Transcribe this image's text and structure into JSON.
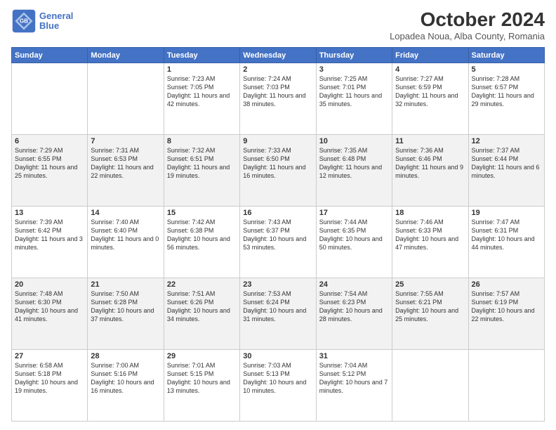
{
  "header": {
    "logo_line1": "General",
    "logo_line2": "Blue",
    "month": "October 2024",
    "location": "Lopadea Noua, Alba County, Romania"
  },
  "days_of_week": [
    "Sunday",
    "Monday",
    "Tuesday",
    "Wednesday",
    "Thursday",
    "Friday",
    "Saturday"
  ],
  "weeks": [
    [
      {
        "day": "",
        "info": ""
      },
      {
        "day": "",
        "info": ""
      },
      {
        "day": "1",
        "info": "Sunrise: 7:23 AM\nSunset: 7:05 PM\nDaylight: 11 hours and 42 minutes."
      },
      {
        "day": "2",
        "info": "Sunrise: 7:24 AM\nSunset: 7:03 PM\nDaylight: 11 hours and 38 minutes."
      },
      {
        "day": "3",
        "info": "Sunrise: 7:25 AM\nSunset: 7:01 PM\nDaylight: 11 hours and 35 minutes."
      },
      {
        "day": "4",
        "info": "Sunrise: 7:27 AM\nSunset: 6:59 PM\nDaylight: 11 hours and 32 minutes."
      },
      {
        "day": "5",
        "info": "Sunrise: 7:28 AM\nSunset: 6:57 PM\nDaylight: 11 hours and 29 minutes."
      }
    ],
    [
      {
        "day": "6",
        "info": "Sunrise: 7:29 AM\nSunset: 6:55 PM\nDaylight: 11 hours and 25 minutes."
      },
      {
        "day": "7",
        "info": "Sunrise: 7:31 AM\nSunset: 6:53 PM\nDaylight: 11 hours and 22 minutes."
      },
      {
        "day": "8",
        "info": "Sunrise: 7:32 AM\nSunset: 6:51 PM\nDaylight: 11 hours and 19 minutes."
      },
      {
        "day": "9",
        "info": "Sunrise: 7:33 AM\nSunset: 6:50 PM\nDaylight: 11 hours and 16 minutes."
      },
      {
        "day": "10",
        "info": "Sunrise: 7:35 AM\nSunset: 6:48 PM\nDaylight: 11 hours and 12 minutes."
      },
      {
        "day": "11",
        "info": "Sunrise: 7:36 AM\nSunset: 6:46 PM\nDaylight: 11 hours and 9 minutes."
      },
      {
        "day": "12",
        "info": "Sunrise: 7:37 AM\nSunset: 6:44 PM\nDaylight: 11 hours and 6 minutes."
      }
    ],
    [
      {
        "day": "13",
        "info": "Sunrise: 7:39 AM\nSunset: 6:42 PM\nDaylight: 11 hours and 3 minutes."
      },
      {
        "day": "14",
        "info": "Sunrise: 7:40 AM\nSunset: 6:40 PM\nDaylight: 11 hours and 0 minutes."
      },
      {
        "day": "15",
        "info": "Sunrise: 7:42 AM\nSunset: 6:38 PM\nDaylight: 10 hours and 56 minutes."
      },
      {
        "day": "16",
        "info": "Sunrise: 7:43 AM\nSunset: 6:37 PM\nDaylight: 10 hours and 53 minutes."
      },
      {
        "day": "17",
        "info": "Sunrise: 7:44 AM\nSunset: 6:35 PM\nDaylight: 10 hours and 50 minutes."
      },
      {
        "day": "18",
        "info": "Sunrise: 7:46 AM\nSunset: 6:33 PM\nDaylight: 10 hours and 47 minutes."
      },
      {
        "day": "19",
        "info": "Sunrise: 7:47 AM\nSunset: 6:31 PM\nDaylight: 10 hours and 44 minutes."
      }
    ],
    [
      {
        "day": "20",
        "info": "Sunrise: 7:48 AM\nSunset: 6:30 PM\nDaylight: 10 hours and 41 minutes."
      },
      {
        "day": "21",
        "info": "Sunrise: 7:50 AM\nSunset: 6:28 PM\nDaylight: 10 hours and 37 minutes."
      },
      {
        "day": "22",
        "info": "Sunrise: 7:51 AM\nSunset: 6:26 PM\nDaylight: 10 hours and 34 minutes."
      },
      {
        "day": "23",
        "info": "Sunrise: 7:53 AM\nSunset: 6:24 PM\nDaylight: 10 hours and 31 minutes."
      },
      {
        "day": "24",
        "info": "Sunrise: 7:54 AM\nSunset: 6:23 PM\nDaylight: 10 hours and 28 minutes."
      },
      {
        "day": "25",
        "info": "Sunrise: 7:55 AM\nSunset: 6:21 PM\nDaylight: 10 hours and 25 minutes."
      },
      {
        "day": "26",
        "info": "Sunrise: 7:57 AM\nSunset: 6:19 PM\nDaylight: 10 hours and 22 minutes."
      }
    ],
    [
      {
        "day": "27",
        "info": "Sunrise: 6:58 AM\nSunset: 5:18 PM\nDaylight: 10 hours and 19 minutes."
      },
      {
        "day": "28",
        "info": "Sunrise: 7:00 AM\nSunset: 5:16 PM\nDaylight: 10 hours and 16 minutes."
      },
      {
        "day": "29",
        "info": "Sunrise: 7:01 AM\nSunset: 5:15 PM\nDaylight: 10 hours and 13 minutes."
      },
      {
        "day": "30",
        "info": "Sunrise: 7:03 AM\nSunset: 5:13 PM\nDaylight: 10 hours and 10 minutes."
      },
      {
        "day": "31",
        "info": "Sunrise: 7:04 AM\nSunset: 5:12 PM\nDaylight: 10 hours and 7 minutes."
      },
      {
        "day": "",
        "info": ""
      },
      {
        "day": "",
        "info": ""
      }
    ]
  ]
}
